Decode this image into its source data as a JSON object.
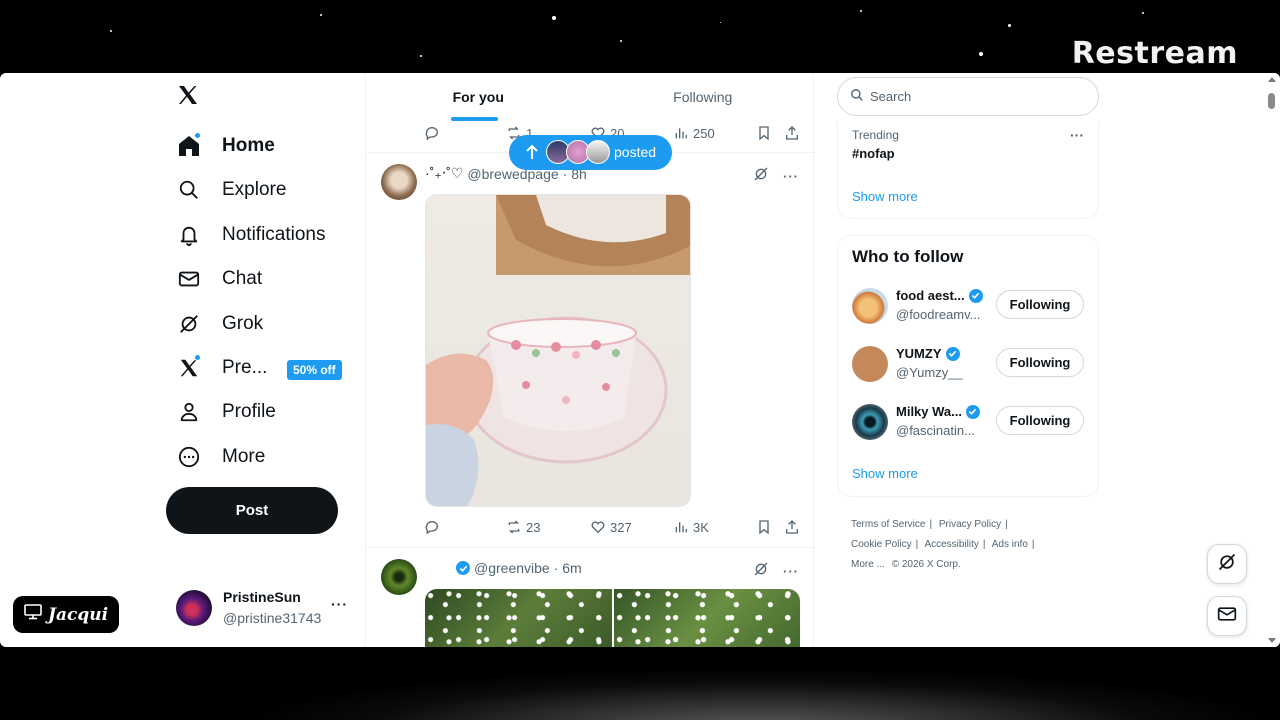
{
  "brand": "Restream",
  "jacqui_label": "Jacqui",
  "nav": {
    "items": [
      {
        "label": "Home"
      },
      {
        "label": "Explore"
      },
      {
        "label": "Notifications"
      },
      {
        "label": "Chat"
      },
      {
        "label": "Grok"
      },
      {
        "label": "Pre..."
      },
      {
        "label": "Profile"
      },
      {
        "label": "More"
      }
    ],
    "premium_badge": "50% off",
    "post_label": "Post"
  },
  "account": {
    "name": "PristineSun",
    "handle": "@pristine31743"
  },
  "tabs": [
    {
      "label": "For you",
      "active": true
    },
    {
      "label": "Following",
      "active": false
    }
  ],
  "top_actions": {
    "reposts": "1",
    "likes": "20",
    "views": "250"
  },
  "posted_pill": "posted",
  "tweets": [
    {
      "name": "·˚₊‧˚♡",
      "handle": "@brewedpage",
      "time": "· 8h",
      "replies": "",
      "reposts": "23",
      "likes": "327",
      "views": "3K"
    },
    {
      "handle": "@greenvibe",
      "time": "· 6m"
    }
  ],
  "search": {
    "placeholder": "Search"
  },
  "trending": {
    "label": "Trending",
    "tag": "#nofap",
    "show_more": "Show more"
  },
  "who_to_follow": {
    "title": "Who to follow",
    "accounts": [
      {
        "name": "food aest...",
        "handle": "@foodreamv...",
        "button": "Following"
      },
      {
        "name": "YUMZY",
        "handle": "@Yumzy__",
        "button": "Following"
      },
      {
        "name": "Milky Wa...",
        "handle": "@fascinatin...",
        "button": "Following"
      }
    ],
    "show_more": "Show more"
  },
  "footer": {
    "links": [
      "Terms of Service",
      "Privacy Policy",
      "Cookie Policy",
      "Accessibility",
      "Ads info",
      "More ...",
      "© 2026 X Corp."
    ]
  },
  "colors": {
    "accent": "#1d9bf0",
    "text": "#0f1419",
    "muted": "#536471"
  }
}
